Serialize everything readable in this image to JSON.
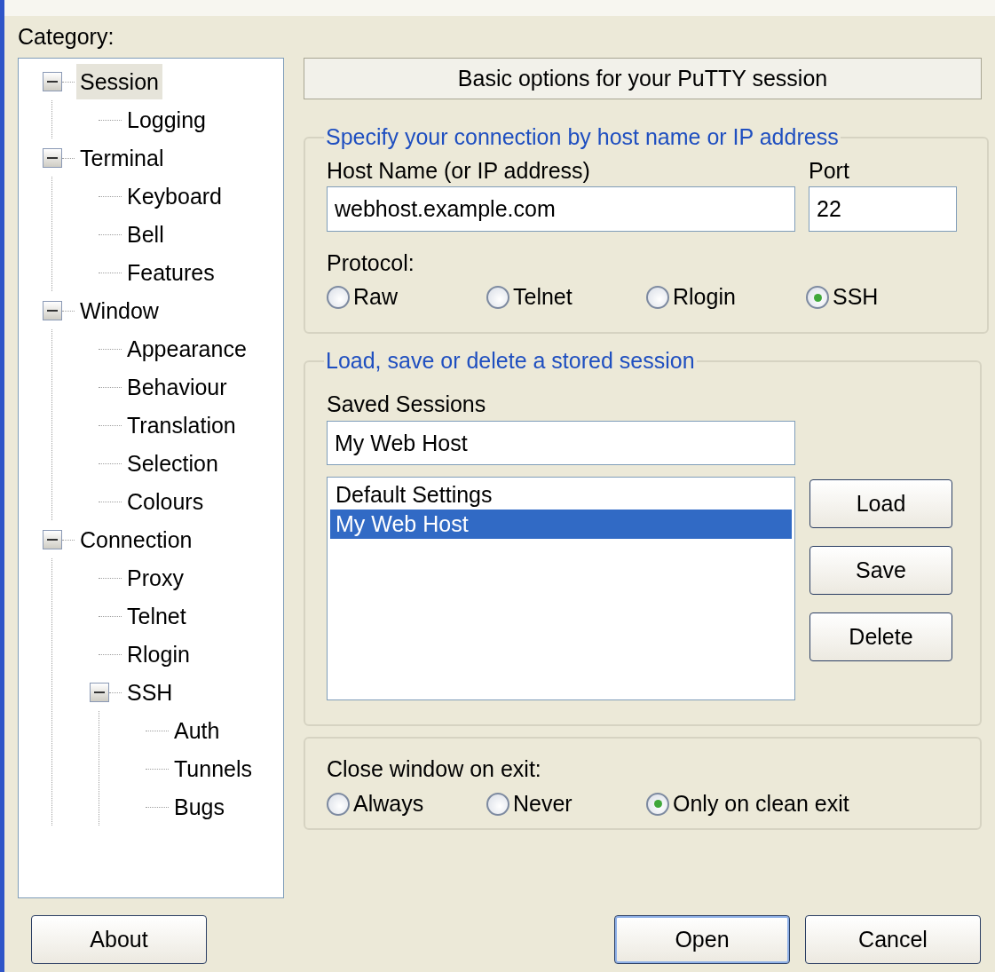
{
  "category_label": "Category:",
  "tree": [
    {
      "label": "Session",
      "selected": true,
      "expanded": true,
      "children": [
        {
          "label": "Logging",
          "selected": false
        }
      ]
    },
    {
      "label": "Terminal",
      "selected": false,
      "expanded": true,
      "children": [
        {
          "label": "Keyboard",
          "selected": false
        },
        {
          "label": "Bell",
          "selected": false
        },
        {
          "label": "Features",
          "selected": false
        }
      ]
    },
    {
      "label": "Window",
      "selected": false,
      "expanded": true,
      "children": [
        {
          "label": "Appearance",
          "selected": false
        },
        {
          "label": "Behaviour",
          "selected": false
        },
        {
          "label": "Translation",
          "selected": false
        },
        {
          "label": "Selection",
          "selected": false
        },
        {
          "label": "Colours",
          "selected": false
        }
      ]
    },
    {
      "label": "Connection",
      "selected": false,
      "expanded": true,
      "children": [
        {
          "label": "Proxy",
          "selected": false
        },
        {
          "label": "Telnet",
          "selected": false
        },
        {
          "label": "Rlogin",
          "selected": false
        },
        {
          "label": "SSH",
          "selected": false,
          "expanded": true,
          "children": [
            {
              "label": "Auth",
              "selected": false
            },
            {
              "label": "Tunnels",
              "selected": false
            },
            {
              "label": "Bugs",
              "selected": false
            }
          ]
        }
      ]
    }
  ],
  "header": "Basic options for your PuTTY session",
  "connection": {
    "legend": "Specify your connection by host name or IP address",
    "host": {
      "label": "Host Name (or IP address)",
      "value": "webhost.example.com"
    },
    "port": {
      "label": "Port",
      "value": "22"
    },
    "protocol": {
      "label": "Protocol:",
      "options": [
        {
          "label": "Raw",
          "selected": false
        },
        {
          "label": "Telnet",
          "selected": false
        },
        {
          "label": "Rlogin",
          "selected": false
        },
        {
          "label": "SSH",
          "selected": true
        }
      ]
    }
  },
  "sessions": {
    "legend": "Load, save or delete a stored session",
    "label": "Saved Sessions",
    "value": "My Web Host",
    "list": [
      {
        "label": "Default Settings",
        "selected": false
      },
      {
        "label": "My Web Host",
        "selected": true
      }
    ],
    "buttons": [
      {
        "label": "Load"
      },
      {
        "label": "Save"
      },
      {
        "label": "Delete"
      }
    ]
  },
  "close_on_exit": {
    "label": "Close window on exit:",
    "options": [
      {
        "label": "Always",
        "selected": false
      },
      {
        "label": "Never",
        "selected": false
      },
      {
        "label": "Only on clean exit",
        "selected": true
      }
    ]
  },
  "buttons": [
    {
      "label": "About",
      "default": false
    },
    {
      "label": "Open",
      "default": true
    },
    {
      "label": "Cancel",
      "default": false
    }
  ]
}
